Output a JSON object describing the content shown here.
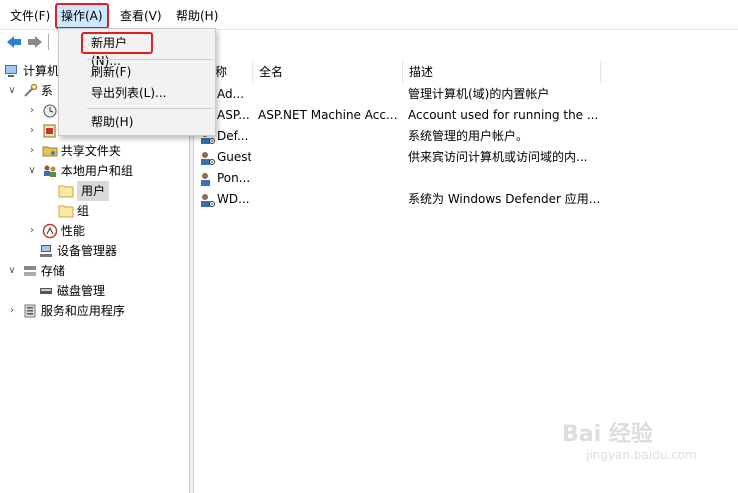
{
  "menubar": {
    "file": "文件(F)",
    "action": "操作(A)",
    "view": "查看(V)",
    "help": "帮助(H)"
  },
  "dropdown": {
    "new_user": "新用户(N)...",
    "refresh": "刷新(F)",
    "export": "导出列表(L)...",
    "help": "帮助(H)"
  },
  "tree": {
    "root": "计算机",
    "system_tools": "系",
    "shared_folders": "共享文件夹",
    "local_users_groups": "本地用户和组",
    "users": "用户",
    "groups": "组",
    "performance": "性能",
    "device_manager": "设备管理器",
    "storage": "存储",
    "disk_management": "磁盘管理",
    "services_apps": "服务和应用程序"
  },
  "list": {
    "columns": [
      "称",
      "全名",
      "描述"
    ],
    "rows": [
      {
        "name": "Ad...",
        "fullname": "",
        "desc": "管理计算机(域)的内置帐户"
      },
      {
        "name": "ASP...",
        "fullname": "ASP.NET Machine Acc...",
        "desc": "Account used for running the ..."
      },
      {
        "name": "Def...",
        "fullname": "",
        "desc": "系统管理的用户帐户。"
      },
      {
        "name": "Guest",
        "fullname": "",
        "desc": "供来宾访问计算机或访问域的内..."
      },
      {
        "name": "Pon...",
        "fullname": "",
        "desc": ""
      },
      {
        "name": "WD...",
        "fullname": "",
        "desc": "系统为 Windows Defender 应用..."
      }
    ]
  },
  "watermark": {
    "brand": "Bai 经验",
    "url": "jingyan.baidu.com"
  },
  "colors": {
    "highlight_border": "#e02020",
    "menu_active_bg": "#cce8ff",
    "selected_bg": "#d9d9d9"
  }
}
